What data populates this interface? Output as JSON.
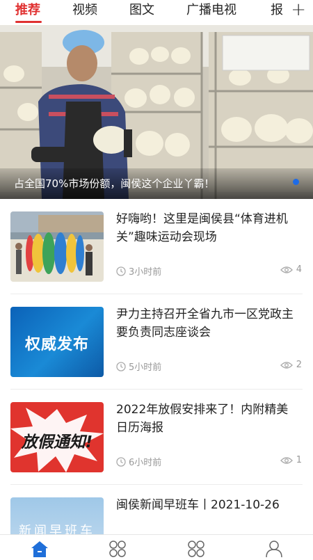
{
  "tabs": [
    {
      "label": "推荐",
      "active": true
    },
    {
      "label": "视频",
      "active": false
    },
    {
      "label": "图文",
      "active": false
    },
    {
      "label": "广播电视",
      "active": false
    },
    {
      "label": "报",
      "active": false
    }
  ],
  "tab_add_icon": "plus-icon",
  "accent_color": "#e03131",
  "hero": {
    "caption": "占全国70%市场份额，闽侯这个企业丫霸！",
    "indicator_color": "#1e6be6"
  },
  "news": [
    {
      "title": "好嗨哟！这里是闽侯县“体育进机关”趣味运动会现场",
      "time": "3小时前",
      "views": "4"
    },
    {
      "title": "尹力主持召开全省九市一区党政主要负责同志座谈会",
      "time": "5小时前",
      "views": "2",
      "thumb_text": "权威发布"
    },
    {
      "title": "2022年放假安排来了！内附精美日历海报",
      "time": "6小时前",
      "views": "1",
      "thumb_text": "放假通知!"
    },
    {
      "title": "闽侯新闻早班车丨2021-10-26",
      "thumb_text": "新闻早班车"
    }
  ],
  "bottom_nav": [
    {
      "icon": "home-icon",
      "active": true
    },
    {
      "icon": "grid-icon",
      "active": false
    },
    {
      "icon": "grid-icon",
      "active": false
    },
    {
      "icon": "user-icon",
      "active": false
    }
  ]
}
